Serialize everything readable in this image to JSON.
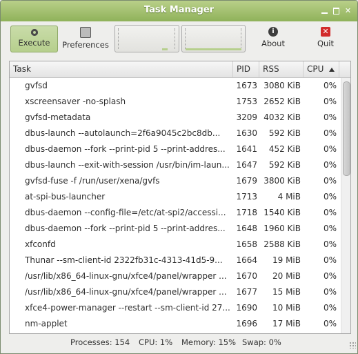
{
  "window": {
    "title": "Task Manager"
  },
  "toolbar": {
    "execute_label": "Execute",
    "preferences_label": "Preferences",
    "about_label": "About",
    "quit_label": "Quit"
  },
  "icons": {
    "execute": "gear-icon",
    "preferences": "preferences-icon",
    "about": "info-icon",
    "quit": "quit-icon"
  },
  "colors": {
    "titlebar": "#9cbb69",
    "active_button": "#c0d69b",
    "quit_icon": "#d22b2b"
  },
  "columns": {
    "task": "Task",
    "pid": "PID",
    "rss": "RSS",
    "cpu": "CPU",
    "sort": "cpu-ascending"
  },
  "processes": [
    {
      "task": "gvfsd",
      "pid": "1673",
      "rss": "3080 KiB",
      "cpu": "0%"
    },
    {
      "task": "xscreensaver -no-splash",
      "pid": "1753",
      "rss": "2652 KiB",
      "cpu": "0%"
    },
    {
      "task": "gvfsd-metadata",
      "pid": "3209",
      "rss": "4032 KiB",
      "cpu": "0%"
    },
    {
      "task": "dbus-launch --autolaunch=2f6a9045c2bc8db...",
      "pid": "1630",
      "rss": "592 KiB",
      "cpu": "0%"
    },
    {
      "task": "dbus-daemon --fork --print-pid 5 --print-addres...",
      "pid": "1641",
      "rss": "452 KiB",
      "cpu": "0%"
    },
    {
      "task": "dbus-launch --exit-with-session /usr/bin/im-laun...",
      "pid": "1647",
      "rss": "592 KiB",
      "cpu": "0%"
    },
    {
      "task": "gvfsd-fuse -f /run/user/xena/gvfs",
      "pid": "1679",
      "rss": "3800 KiB",
      "cpu": "0%"
    },
    {
      "task": "at-spi-bus-launcher",
      "pid": "1713",
      "rss": "4 MiB",
      "cpu": "0%"
    },
    {
      "task": "dbus-daemon --config-file=/etc/at-spi2/accessi...",
      "pid": "1718",
      "rss": "1540 KiB",
      "cpu": "0%"
    },
    {
      "task": "dbus-daemon --fork --print-pid 5 --print-addres...",
      "pid": "1648",
      "rss": "1960 KiB",
      "cpu": "0%"
    },
    {
      "task": "xfconfd",
      "pid": "1658",
      "rss": "2588 KiB",
      "cpu": "0%"
    },
    {
      "task": "Thunar --sm-client-id 2322fb31c-4313-41d5-9...",
      "pid": "1664",
      "rss": "19 MiB",
      "cpu": "0%"
    },
    {
      "task": "/usr/lib/x86_64-linux-gnu/xfce4/panel/wrapper ...",
      "pid": "1670",
      "rss": "20 MiB",
      "cpu": "0%"
    },
    {
      "task": "/usr/lib/x86_64-linux-gnu/xfce4/panel/wrapper ...",
      "pid": "1677",
      "rss": "15 MiB",
      "cpu": "0%"
    },
    {
      "task": "xfce4-power-manager --restart --sm-client-id 27...",
      "pid": "1690",
      "rss": "10 MiB",
      "cpu": "0%"
    },
    {
      "task": "nm-applet",
      "pid": "1696",
      "rss": "17 MiB",
      "cpu": "0%"
    }
  ],
  "status": {
    "processes": "Processes: 154",
    "cpu": "CPU: 1%",
    "memory": "Memory: 15%",
    "swap": "Swap: 0%"
  },
  "graphs": {
    "cpu_percent": 1,
    "memory_percent": 15
  }
}
